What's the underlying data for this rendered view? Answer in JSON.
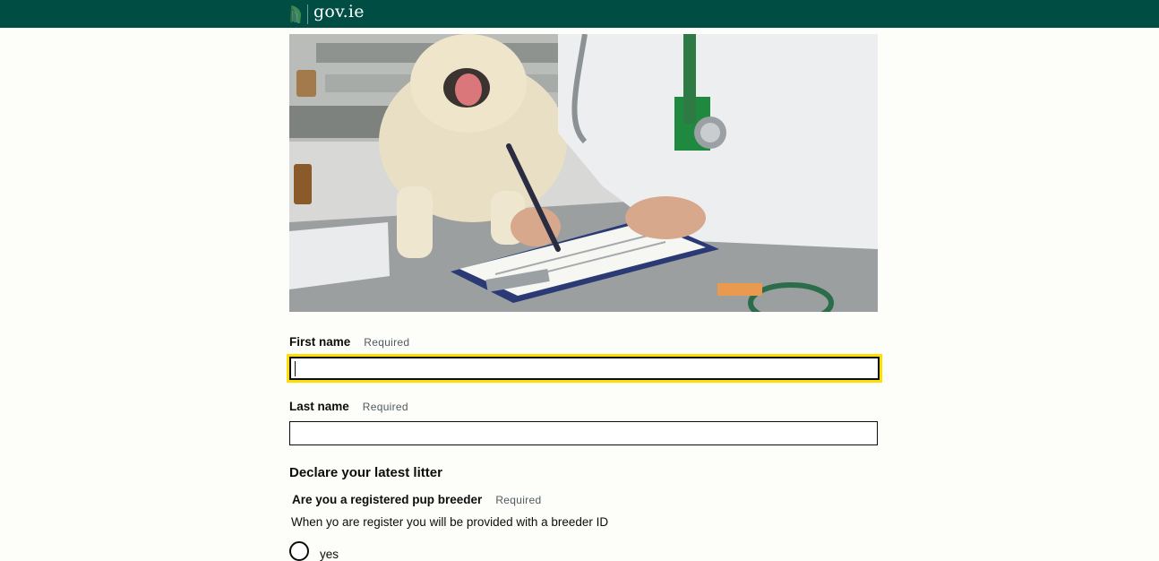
{
  "header": {
    "brand_text": "gov.ie",
    "logo_icon": "harp-icon",
    "background": "#004d44"
  },
  "hero_image": {
    "subject": "veterinarian writing on clipboard beside dog"
  },
  "form": {
    "first_name": {
      "label": "First name",
      "required": "Required",
      "value": ""
    },
    "last_name": {
      "label": "Last name",
      "required": "Required",
      "value": ""
    },
    "section_heading": "Declare your latest litter",
    "breeder_question": {
      "label": "Are you a registered pup breeder",
      "required": "Required",
      "hint": "When yo are register you will be provided with a breeder ID",
      "options": [
        {
          "label": "yes",
          "selected": false
        }
      ]
    }
  },
  "colors": {
    "focus": "#ffdd00",
    "header": "#004d44",
    "text": "#0b0c0c"
  }
}
